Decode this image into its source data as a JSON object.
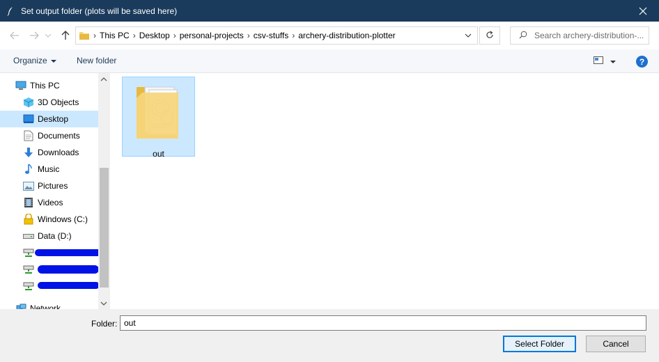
{
  "window": {
    "title": "Set output folder (plots will be saved here)",
    "icons": {
      "app": "feather-icon",
      "close": "close-icon"
    }
  },
  "navigation": {
    "breadcrumbs": [
      "This PC",
      "Desktop",
      "personal-projects",
      "csv-stuffs",
      "archery-distribution-plotter"
    ],
    "search_placeholder": "Search archery-distribution-..."
  },
  "toolbar": {
    "organize_label": "Organize",
    "new_folder_label": "New folder",
    "help_label": "?"
  },
  "sidebar": {
    "items": [
      {
        "label": "This PC",
        "icon": "computer-icon",
        "selected": false
      },
      {
        "label": "3D Objects",
        "icon": "cube-icon",
        "selected": false
      },
      {
        "label": "Desktop",
        "icon": "desktop-icon",
        "selected": true
      },
      {
        "label": "Documents",
        "icon": "document-icon",
        "selected": false
      },
      {
        "label": "Downloads",
        "icon": "download-icon",
        "selected": false
      },
      {
        "label": "Music",
        "icon": "music-icon",
        "selected": false
      },
      {
        "label": "Pictures",
        "icon": "picture-icon",
        "selected": false
      },
      {
        "label": "Videos",
        "icon": "video-icon",
        "selected": false
      },
      {
        "label": "Windows (C:)",
        "icon": "drive-icon",
        "selected": false
      },
      {
        "label": "Data (D:)",
        "icon": "drive-icon",
        "selected": false
      },
      {
        "label": "",
        "icon": "network-drive-icon",
        "selected": false,
        "redacted": true
      },
      {
        "label": "",
        "icon": "network-drive-icon",
        "selected": false,
        "redacted": true
      },
      {
        "label": "",
        "icon": "network-drive-icon",
        "selected": false,
        "redacted": true
      },
      {
        "label": "Network",
        "icon": "network-icon",
        "selected": false
      }
    ]
  },
  "files": [
    {
      "name": "out",
      "type": "folder",
      "selected": true
    }
  ],
  "footer": {
    "folder_label": "Folder:",
    "folder_value": "out",
    "select_button": "Select Folder",
    "cancel_button": "Cancel"
  },
  "colors": {
    "titlebar": "#1a3b5c",
    "selection": "#cce8ff",
    "accent": "#0078d7",
    "redaction": "#0012e6"
  }
}
